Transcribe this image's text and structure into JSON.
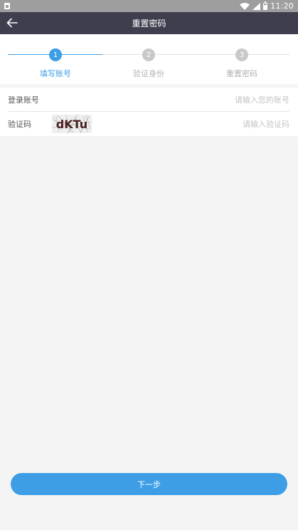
{
  "status_bar": {
    "time": "11:20"
  },
  "header": {
    "title": "重置密码"
  },
  "steps": [
    {
      "number": "1",
      "label": "填写账号",
      "active": true
    },
    {
      "number": "2",
      "label": "验证身份",
      "active": false
    },
    {
      "number": "3",
      "label": "重置密码",
      "active": false
    }
  ],
  "colors": {
    "active": "#3d9ee6",
    "inactive": "#c9c9c9",
    "inactive_text": "#b3b3b3",
    "header_bg": "#3e3e4e"
  },
  "form": {
    "account_label": "登录账号",
    "account_placeholder": "请输入您的账号",
    "code_label": "验证码",
    "code_placeholder": "请输入验证码",
    "captcha_text": "dKTu"
  },
  "next_button": {
    "label": "下一步"
  }
}
